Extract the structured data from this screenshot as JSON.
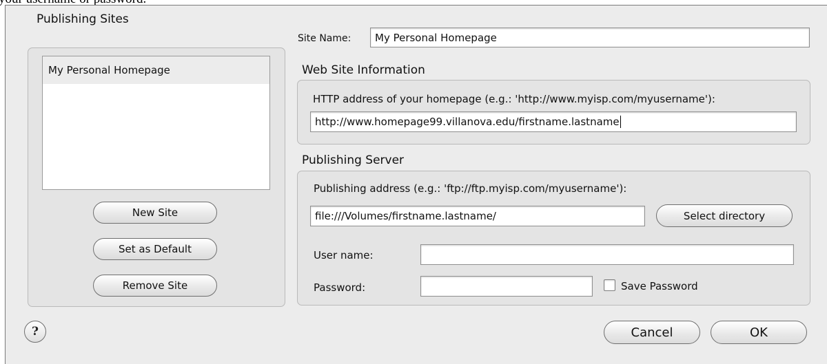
{
  "document": {
    "cutoff_text": "your username or password."
  },
  "sites_panel": {
    "title": "Publishing Sites",
    "items": [
      {
        "label": "My Personal Homepage",
        "selected": true
      }
    ],
    "new_site_label": "New Site",
    "set_default_label": "Set as Default",
    "remove_site_label": "Remove Site"
  },
  "site_name": {
    "label": "Site Name:",
    "value": "My Personal Homepage"
  },
  "web_info": {
    "title": "Web Site Information",
    "http_label": "HTTP address of your homepage (e.g.: 'http://www.myisp.com/myusername'):",
    "http_value": "http://www.homepage99.villanova.edu/firstname.lastname"
  },
  "server": {
    "title": "Publishing Server",
    "address_label": "Publishing address (e.g.: 'ftp://ftp.myisp.com/myusername'):",
    "address_value": "file:///Volumes/firstname.lastname/",
    "select_dir_label": "Select directory",
    "username_label": "User name:",
    "username_value": "",
    "password_label": "Password:",
    "password_value": "",
    "save_password_label": "Save Password",
    "save_password_checked": false
  },
  "footer": {
    "help_label": "?",
    "cancel_label": "Cancel",
    "ok_label": "OK"
  }
}
